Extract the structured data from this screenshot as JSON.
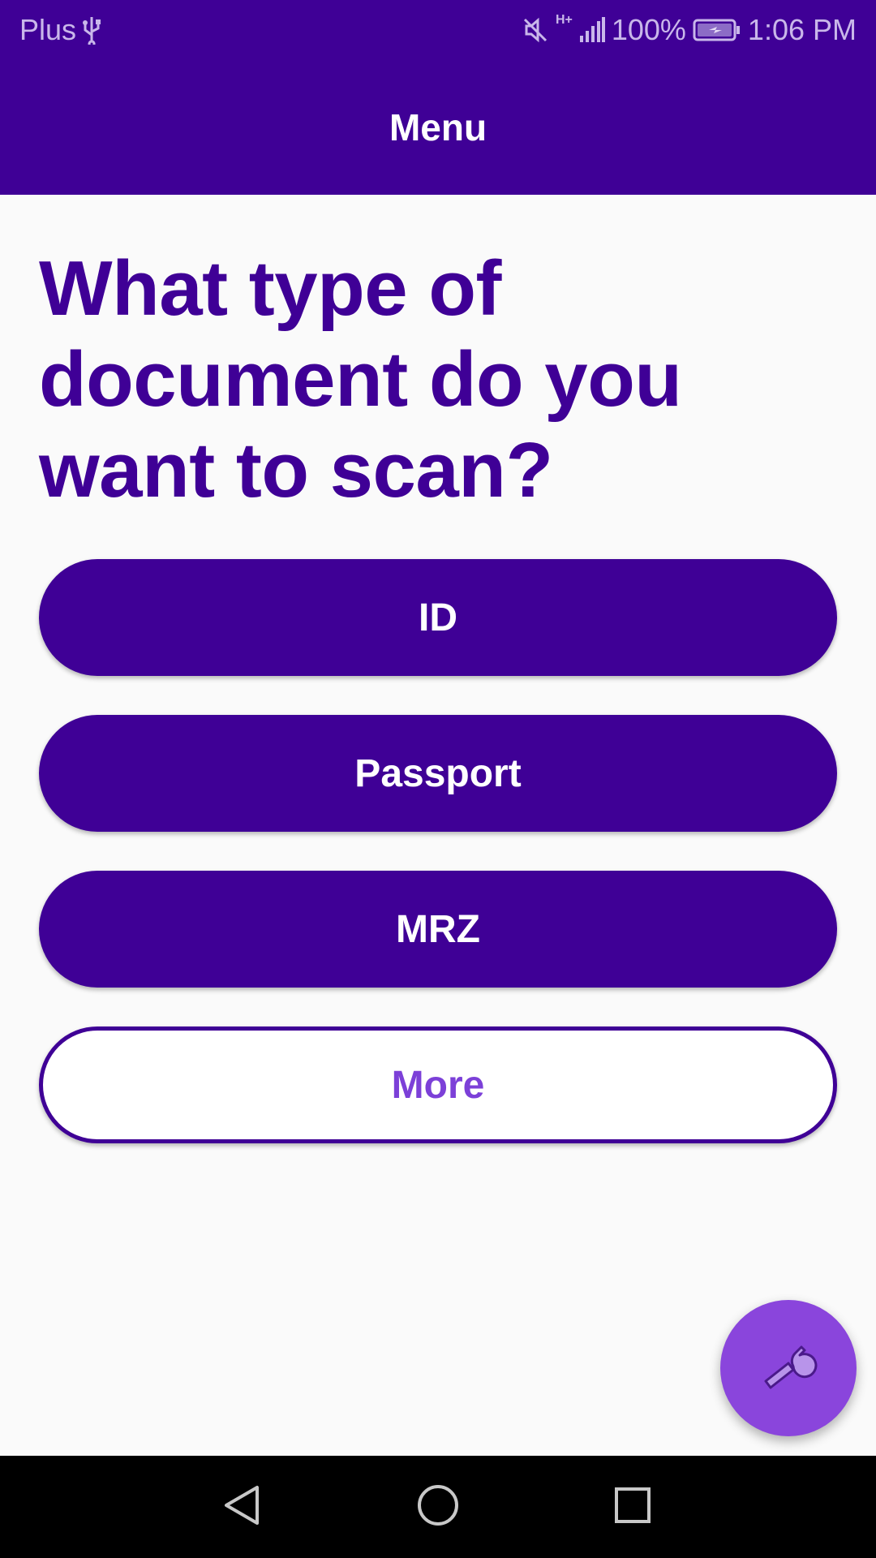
{
  "status_bar": {
    "carrier": "Plus",
    "battery": "100%",
    "time": "1:06 PM",
    "network": "H+",
    "icons": [
      "usb-icon",
      "mute-icon",
      "signal-icon",
      "battery-charging-icon"
    ]
  },
  "app_bar": {
    "title": "Menu"
  },
  "main": {
    "question": "What type of document do you want to scan?",
    "buttons": {
      "id": "ID",
      "passport": "Passport",
      "mrz": "MRZ",
      "more": "More"
    }
  },
  "fab": {
    "icon": "wrench-icon"
  },
  "nav_bar": {
    "icons": [
      "back-icon",
      "home-icon",
      "recents-icon"
    ]
  },
  "colors": {
    "primary": "#3f0096",
    "accent": "#8a45dc",
    "more_text": "#7c40d8",
    "background": "#fafafa"
  }
}
